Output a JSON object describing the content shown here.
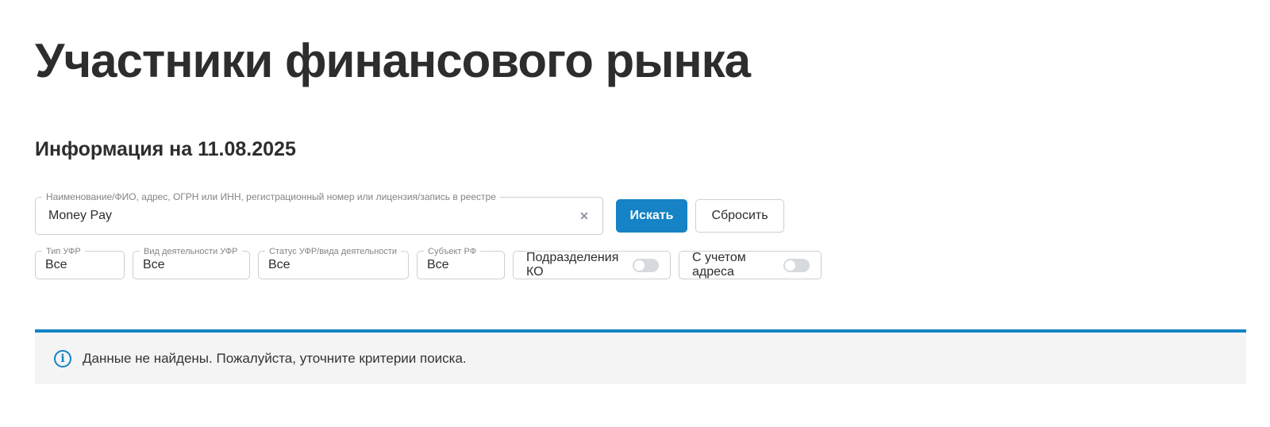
{
  "page": {
    "title": "Участники финансового рынка",
    "info_date": "Информация на 11.08.2025"
  },
  "search": {
    "label": "Наименование/ФИО, адрес, ОГРН или ИНН, регистрационный номер или лицензия/запись в реестре",
    "value": "Money Pay",
    "clear_icon": "✕",
    "search_button": "Искать",
    "reset_button": "Сбросить"
  },
  "filters": {
    "selects": [
      {
        "label": "Тип УФР",
        "value": "Все"
      },
      {
        "label": "Вид деятельности УФР",
        "value": "Все"
      },
      {
        "label": "Статус УФР/вида деятельности",
        "value": "Все"
      },
      {
        "label": "Субъект РФ",
        "value": "Все"
      }
    ],
    "toggles": [
      {
        "label": "Подразделения КО",
        "state": "off"
      },
      {
        "label": "С учетом адреса",
        "state": "off"
      }
    ]
  },
  "results": {
    "info_icon": "i",
    "message": "Данные не найдены. Пожалуйста, уточните критерии поиска."
  },
  "colors": {
    "accent_blue": "#1583c5",
    "info_background": "#f4f4f5",
    "border_gray": "#cfcfcf",
    "label_gray": "#848484",
    "text_dark": "#2d2d2d",
    "toggle_gray": "#d6d9de"
  }
}
